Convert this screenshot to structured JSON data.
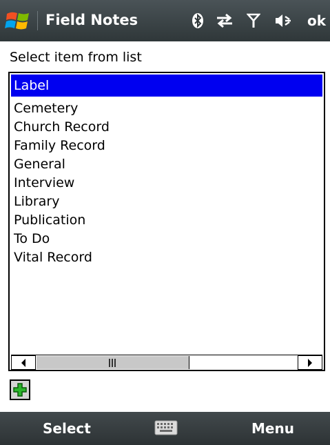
{
  "titlebar": {
    "app_title": "Field Notes",
    "ok_label": "ok",
    "icons": [
      "windows-start-icon",
      "bluetooth-icon",
      "sync-icon",
      "signal-icon",
      "volume-icon"
    ]
  },
  "prompt": "Select item from list",
  "list": {
    "header": "Label",
    "items": [
      "Cemetery",
      "Church Record",
      "Family Record",
      "General",
      "Interview",
      "Library",
      "Publication",
      "To Do",
      "Vital Record"
    ]
  },
  "add_button": {
    "icon": "plus-icon",
    "color": "#2bb52b"
  },
  "menubar": {
    "left_softkey": "Select",
    "right_softkey": "Menu",
    "center_icon": "keyboard-icon"
  },
  "colors": {
    "title_bar": "#3a4346",
    "selection": "#0000f0",
    "menu_bar": "#383f42"
  }
}
